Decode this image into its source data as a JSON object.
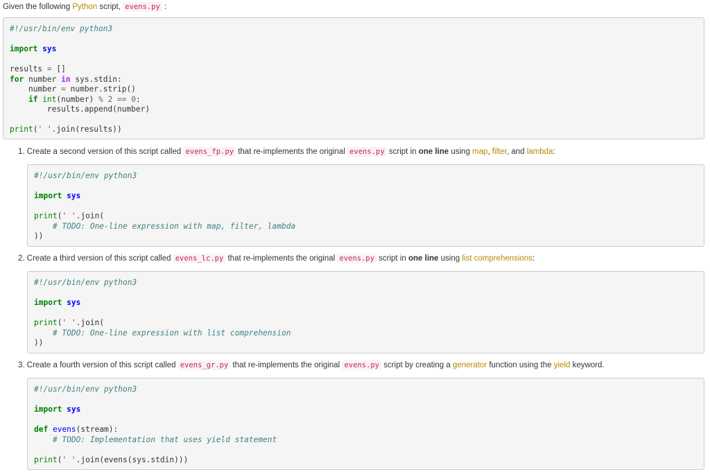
{
  "intro": {
    "prefix": "Given the following",
    "python_link": "Python",
    "middle": "script,",
    "filename": "evens.py",
    "suffix": ":"
  },
  "main_code": {
    "shebang": "#!/usr/bin/env python3",
    "import_kw": "import",
    "import_mod": "sys",
    "results": "results",
    "eq": "=",
    "empty_list": "[]",
    "for_kw": "for",
    "number": "number",
    "in_kw": "in",
    "stdin": "sys.stdin:",
    "strip": "number.strip()",
    "if_kw": "if",
    "int_bi": "int",
    "int_arg": "(number)",
    "mod": "%",
    "two": "2",
    "eqeq": "==",
    "zero": "0",
    "colon": ":",
    "append": "results.append(number)",
    "print_bi": "print",
    "open_paren": "(",
    "space_str": "' '",
    "join_results": ".join(results))"
  },
  "q1": {
    "number": "1.",
    "t1": "Create a second version of this script called",
    "file": "evens_fp.py",
    "t2": "that re-implements the original",
    "orig": "evens.py",
    "t3": "script in",
    "bold": "one line",
    "t4": "using",
    "map": "map",
    "comma1": ",",
    "filter": "filter",
    "and": ", and",
    "lambda": "lambda",
    "end": ":"
  },
  "code1": {
    "shebang": "#!/usr/bin/env python3",
    "import_kw": "import",
    "import_mod": "sys",
    "print_bi": "print",
    "open": "(",
    "space_str": "' '",
    "join": ".join(",
    "todo": "# TODO: One-line expression with map, filter, lambda",
    "close": "))"
  },
  "q2": {
    "number": "2.",
    "t1": "Create a third version of this script called",
    "file": "evens_lc.py",
    "t2": "that re-implements the original",
    "orig": "evens.py",
    "t3": "script in",
    "bold": "one line",
    "t4": "using",
    "link": "list comprehensions",
    "end": ":"
  },
  "code2": {
    "shebang": "#!/usr/bin/env python3",
    "import_kw": "import",
    "import_mod": "sys",
    "print_bi": "print",
    "open": "(",
    "space_str": "' '",
    "join": ".join(",
    "todo": "# TODO: One-line expression with list comprehension",
    "close": "))"
  },
  "q3": {
    "number": "3.",
    "t1": "Create a fourth version of this script called",
    "file": "evens_gr.py",
    "t2": "that re-implements the original",
    "orig": "evens.py",
    "t3": "script by creating a",
    "generator": "generator",
    "t4": "function using the",
    "yield": "yield",
    "end": "keyword."
  },
  "code3": {
    "shebang": "#!/usr/bin/env python3",
    "import_kw": "import",
    "import_mod": "sys",
    "def_kw": "def",
    "fn_name": "evens",
    "params": "(stream):",
    "todo": "# TODO: Implementation that uses yield statement",
    "print_bi": "print",
    "open": "(",
    "space_str": "' '",
    "join": ".join(evens(sys.stdin)))"
  }
}
